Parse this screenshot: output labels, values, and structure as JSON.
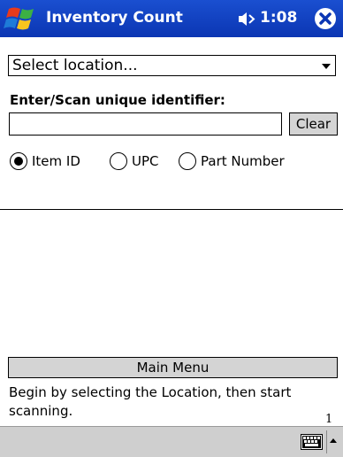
{
  "app": {
    "title": "Inventory Count",
    "time": "1:08"
  },
  "icons": {
    "start": "windows-flag-icon",
    "volume": "speaker-icon",
    "close": "close-circle-icon",
    "keyboard": "keyboard-icon",
    "sip_toggle": "caret-up-icon"
  },
  "location": {
    "selected": "Select location..."
  },
  "identifier": {
    "label": "Enter/Scan unique identifier:",
    "value": "",
    "clear_label": "Clear"
  },
  "id_type": {
    "options": [
      "Item ID",
      "UPC",
      "Part Number"
    ],
    "selected": "Item ID"
  },
  "main_menu_label": "Main Menu",
  "instructions": "Begin by selecting the Location, then start scanning.",
  "counter": "1",
  "colors": {
    "titlebar": "#0b36b3",
    "button_bg": "#d4d4d4",
    "bottombar": "#cfcfcf"
  }
}
